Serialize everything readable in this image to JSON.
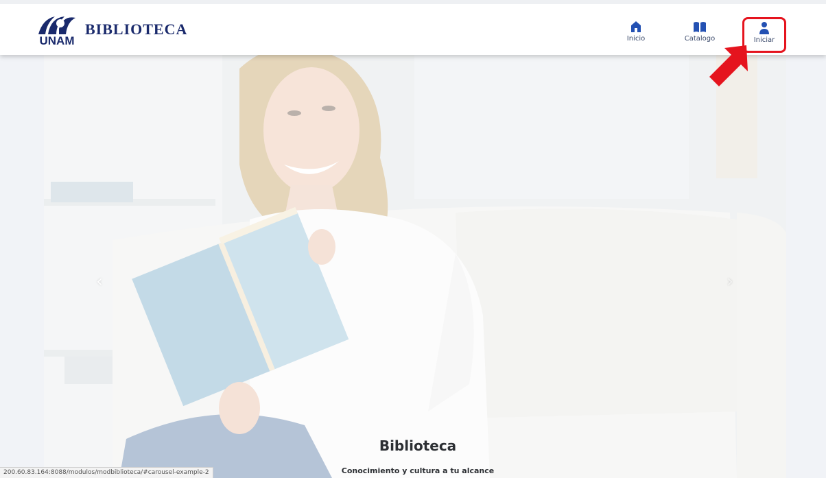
{
  "brand": {
    "logo_text": "UNAM",
    "name": "BIBLIOTECA"
  },
  "nav": {
    "items": [
      {
        "label": "Inicio",
        "icon": "home-icon"
      },
      {
        "label": "Catalogo",
        "icon": "book-icon"
      },
      {
        "label": "Iniciar",
        "icon": "user-icon"
      }
    ],
    "highlight_color": "#e5141e"
  },
  "carousel": {
    "prev_glyph": "‹",
    "next_glyph": "›",
    "caption_title": "Biblioteca",
    "caption_subtitle": "Conocimiento y cultura a tu alcance"
  },
  "status_bar": {
    "url": "200.60.83.164:8088/modulos/modbiblioteca/#carousel-example-2"
  },
  "colors": {
    "brand": "#1a2a6c",
    "accent": "#2451b3",
    "annotation_arrow": "#e5141e"
  }
}
